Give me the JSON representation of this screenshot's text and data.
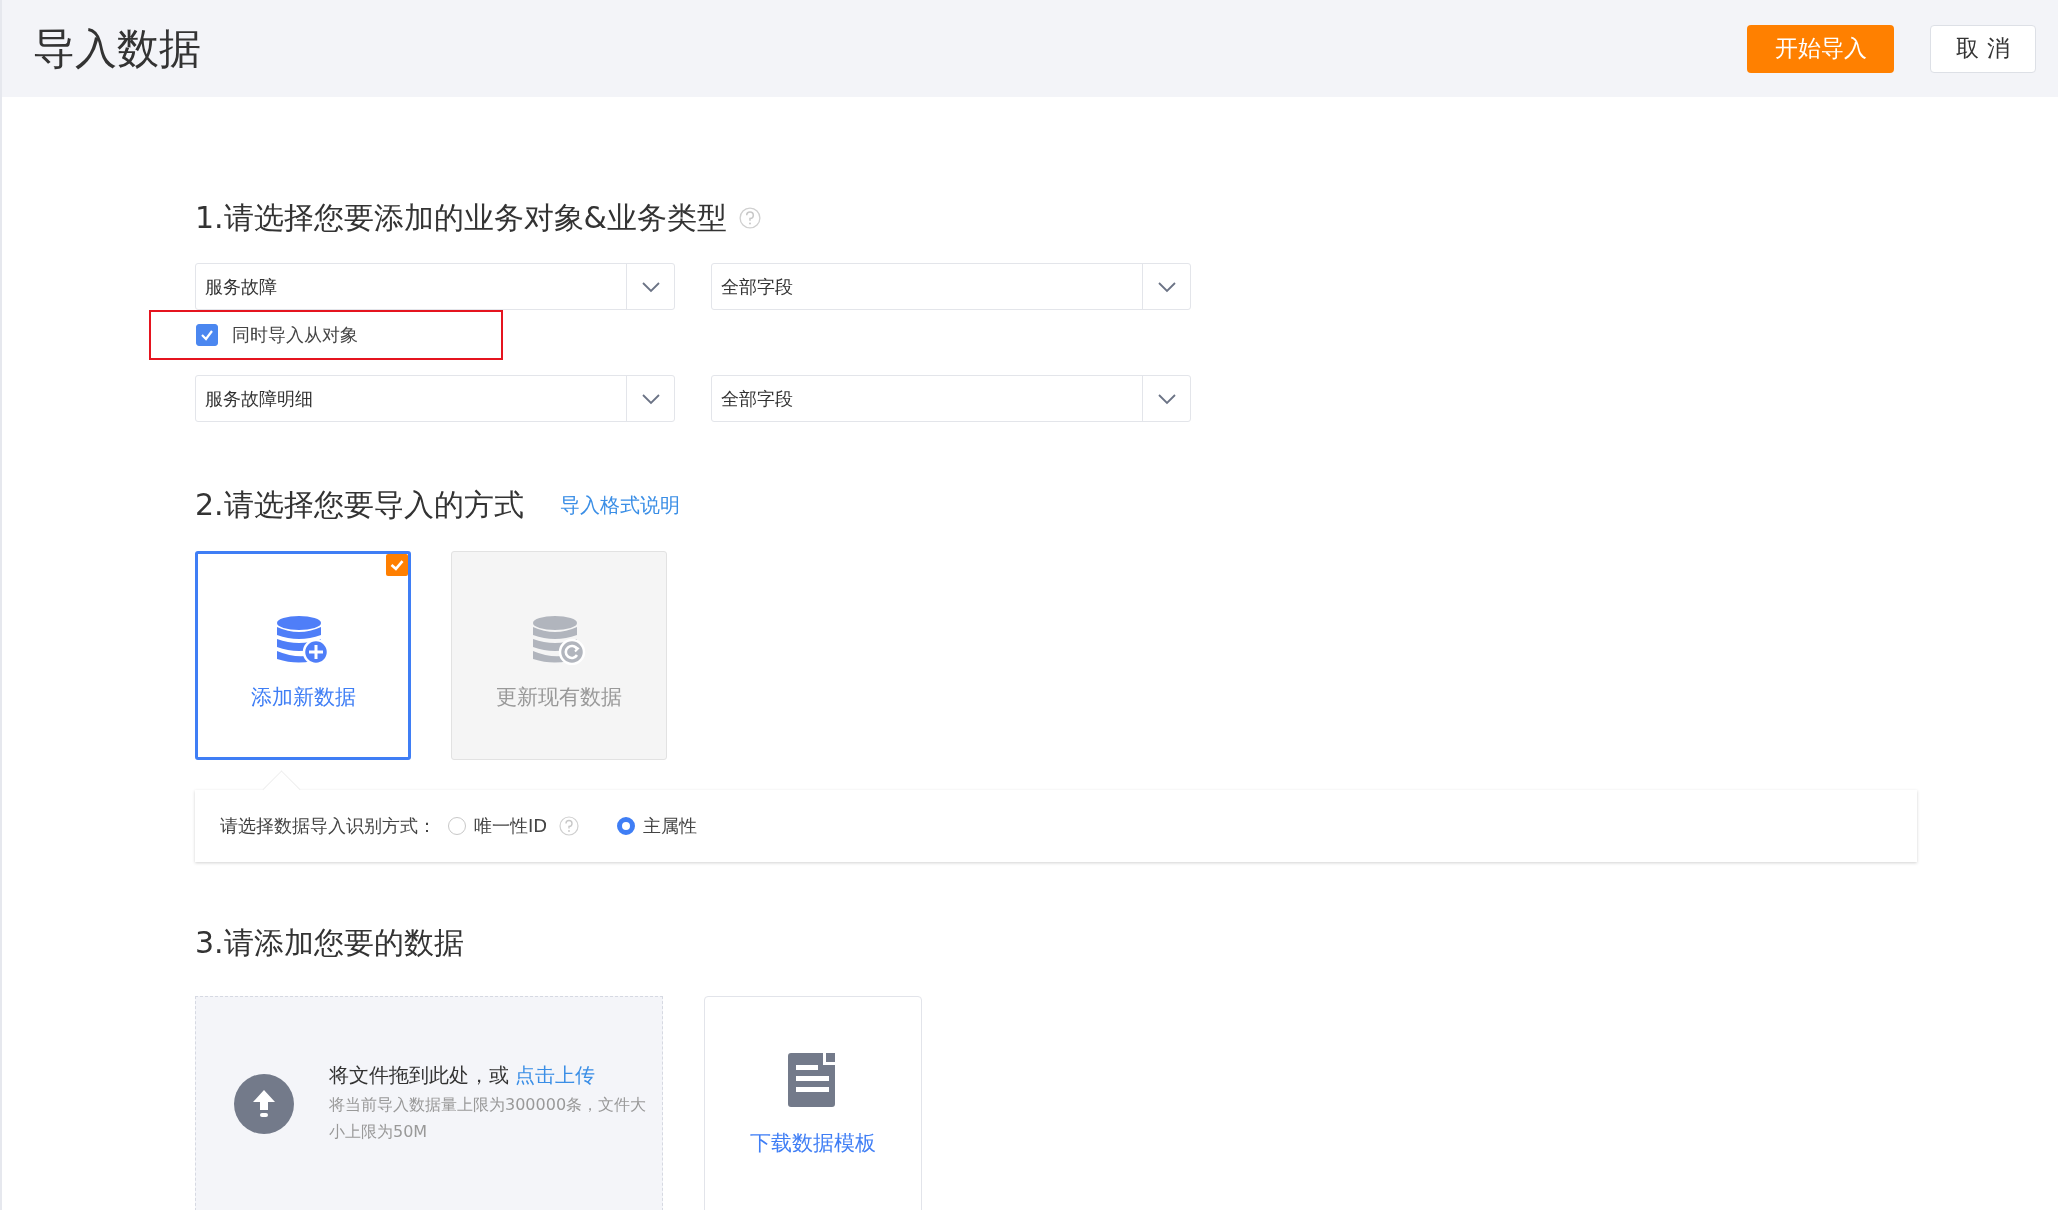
{
  "header": {
    "title": "导入数据",
    "buttons": [
      {
        "label": "开始导入",
        "kind": "primary"
      },
      {
        "label": "取 消",
        "kind": "default"
      }
    ]
  },
  "section1": {
    "title": "1.请选择您要添加的业务对象&业务类型",
    "rows": [
      {
        "kind": "selects",
        "selects": [
          "服务故障",
          "全部字段"
        ]
      },
      {
        "kind": "checkbox",
        "label": "同时导入从对象",
        "checked": true,
        "highlighted": true
      },
      {
        "kind": "selects",
        "selects": [
          "服务故障明细",
          "全部字段"
        ]
      }
    ]
  },
  "section2": {
    "title": "2.请选择您要导入的方式",
    "link": "导入格式说明",
    "methods": [
      {
        "label": "添加新数据",
        "kind": "add",
        "selected": true
      },
      {
        "label": "更新现有数据",
        "kind": "update",
        "selected": false
      }
    ],
    "identify": {
      "label": "请选择数据导入识别方式：",
      "options": [
        {
          "label": "唯一性ID",
          "help": true,
          "selected": false
        },
        {
          "label": "主属性",
          "help": false,
          "selected": true
        }
      ]
    }
  },
  "section3": {
    "title": "3.请添加您要的数据",
    "upload": {
      "text": "将文件拖到此处，或",
      "link": "点击上传",
      "hint": "将当前导入数据量上限为300000条，文件大小上限为50M"
    },
    "template": {
      "label": "下载数据模板"
    }
  }
}
